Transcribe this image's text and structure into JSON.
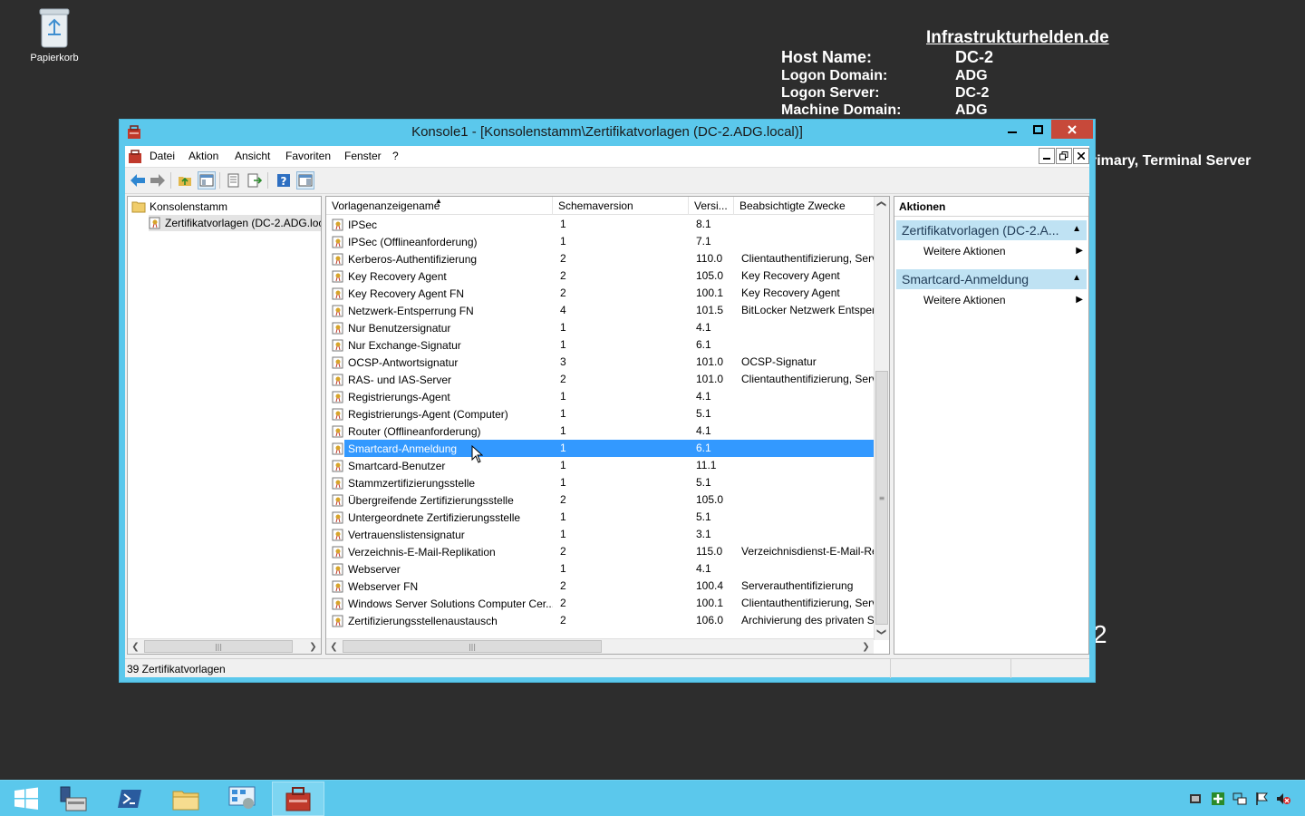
{
  "desktop": {
    "recycle_bin_label": "Papierkorb",
    "bginfo": {
      "site": "Infrastrukturhelden.de",
      "rows": [
        {
          "key": "Host Name:",
          "value": "DC-2"
        },
        {
          "key": "Logon Domain:",
          "value": "ADG"
        },
        {
          "key": "Logon Server:",
          "value": "DC-2"
        },
        {
          "key": "Machine Domain:",
          "value": "ADG"
        }
      ],
      "extra_line_fragment": "rimary, Terminal Server",
      "fragment_char": "2"
    }
  },
  "window": {
    "title": "Konsole1 - [Konsolenstamm\\Zertifikatvorlagen (DC-2.ADG.local)]",
    "menu": [
      "Datei",
      "Aktion",
      "Ansicht",
      "Favoriten",
      "Fenster",
      "?"
    ]
  },
  "tree": {
    "root": "Konsolenstamm",
    "child": "Zertifikatvorlagen (DC-2.ADG.local)"
  },
  "list": {
    "columns": [
      "Vorlagenanzeigename",
      "Schemaversion",
      "Versi...",
      "Beabsichtigte Zwecke"
    ],
    "rows": [
      {
        "name": "IPSec",
        "schema": "1",
        "version": "8.1",
        "purpose": ""
      },
      {
        "name": "IPSec (Offlineanforderung)",
        "schema": "1",
        "version": "7.1",
        "purpose": ""
      },
      {
        "name": "Kerberos-Authentifizierung",
        "schema": "2",
        "version": "110.0",
        "purpose": "Clientauthentifizierung, Serv"
      },
      {
        "name": "Key Recovery Agent",
        "schema": "2",
        "version": "105.0",
        "purpose": "Key Recovery Agent"
      },
      {
        "name": "Key Recovery Agent FN",
        "schema": "2",
        "version": "100.1",
        "purpose": "Key Recovery Agent"
      },
      {
        "name": "Netzwerk-Entsperrung FN",
        "schema": "4",
        "version": "101.5",
        "purpose": "BitLocker Netzwerk Entsperr"
      },
      {
        "name": "Nur Benutzersignatur",
        "schema": "1",
        "version": "4.1",
        "purpose": ""
      },
      {
        "name": "Nur Exchange-Signatur",
        "schema": "1",
        "version": "6.1",
        "purpose": ""
      },
      {
        "name": "OCSP-Antwortsignatur",
        "schema": "3",
        "version": "101.0",
        "purpose": "OCSP-Signatur"
      },
      {
        "name": "RAS- und IAS-Server",
        "schema": "2",
        "version": "101.0",
        "purpose": "Clientauthentifizierung, Serv"
      },
      {
        "name": "Registrierungs-Agent",
        "schema": "1",
        "version": "4.1",
        "purpose": ""
      },
      {
        "name": "Registrierungs-Agent (Computer)",
        "schema": "1",
        "version": "5.1",
        "purpose": ""
      },
      {
        "name": "Router (Offlineanforderung)",
        "schema": "1",
        "version": "4.1",
        "purpose": ""
      },
      {
        "name": "Smartcard-Anmeldung",
        "schema": "1",
        "version": "6.1",
        "purpose": "",
        "selected": true
      },
      {
        "name": "Smartcard-Benutzer",
        "schema": "1",
        "version": "11.1",
        "purpose": ""
      },
      {
        "name": "Stammzertifizierungsstelle",
        "schema": "1",
        "version": "5.1",
        "purpose": ""
      },
      {
        "name": "Übergreifende Zertifizierungsstelle",
        "schema": "2",
        "version": "105.0",
        "purpose": ""
      },
      {
        "name": "Untergeordnete Zertifizierungsstelle",
        "schema": "1",
        "version": "5.1",
        "purpose": ""
      },
      {
        "name": "Vertrauenslistensignatur",
        "schema": "1",
        "version": "3.1",
        "purpose": ""
      },
      {
        "name": "Verzeichnis-E-Mail-Replikation",
        "schema": "2",
        "version": "115.0",
        "purpose": "Verzeichnisdienst-E-Mail-Re"
      },
      {
        "name": "Webserver",
        "schema": "1",
        "version": "4.1",
        "purpose": ""
      },
      {
        "name": "Webserver FN",
        "schema": "2",
        "version": "100.4",
        "purpose": "Serverauthentifizierung"
      },
      {
        "name": "Windows Server Solutions Computer Cer...",
        "schema": "2",
        "version": "100.1",
        "purpose": "Clientauthentifizierung, Serv"
      },
      {
        "name": "Zertifizierungsstellenaustausch",
        "schema": "2",
        "version": "106.0",
        "purpose": "Archivierung des privaten Sc"
      }
    ]
  },
  "actions": {
    "header": "Aktionen",
    "sections": [
      {
        "title": "Zertifikatvorlagen (DC-2.A...",
        "item": "Weitere Aktionen"
      },
      {
        "title": "Smartcard-Anmeldung",
        "item": "Weitere Aktionen"
      }
    ]
  },
  "status": {
    "text": "39 Zertifikatvorlagen"
  },
  "taskbar": {
    "apps": [
      "start",
      "server-manager",
      "powershell",
      "file-explorer",
      "control-panel",
      "mmc-console"
    ]
  },
  "colors": {
    "selection": "#3399ff",
    "window_frame": "#5bc8ec",
    "desktop": "#2d2d2d",
    "actions_section": "#bfe2f3"
  }
}
